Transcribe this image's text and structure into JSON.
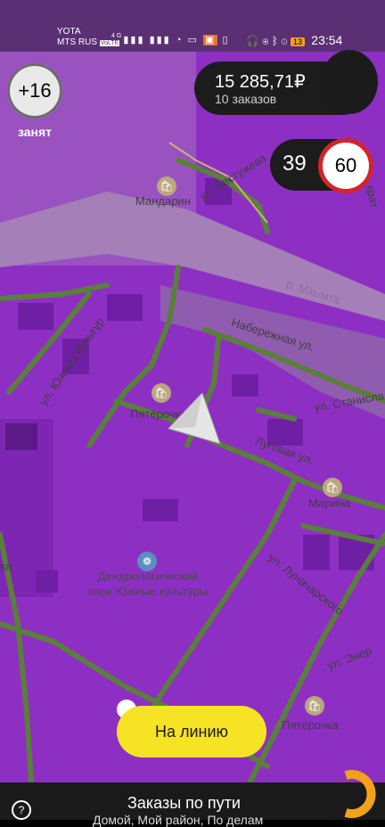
{
  "status_bar": {
    "carrier1": "YOTA",
    "carrier2": "MTS RUS",
    "network_type": "4G",
    "volte_label": "VoLTE",
    "battery": "13",
    "time": "23:54"
  },
  "driver": {
    "bonus": "+16",
    "status": "занят"
  },
  "earnings": {
    "amount": "15 285,71₽",
    "orders": "10 заказов"
  },
  "speed": {
    "current": "39",
    "limit": "60"
  },
  "map": {
    "labels": {
      "bestuzheva": "ул. Бестужева",
      "mandarin": "Мандарин",
      "mzymta": "р. Мзымта",
      "naberezhnaya": "Набережная ул.",
      "yuzhnye_kultury": "ул. Южных Культур",
      "pyaterochka1": "Пятёрочка",
      "stanislav": "ул. Станисла",
      "lugovaya": "Луговая ул.",
      "marina": "Марина",
      "dendropark": "Дендрологический парк Южные культуры",
      "lunacharskogo": "ул. Луначарского",
      "energ": "ул. Энер",
      "pyaterochka2": "Пятёрочка",
      "krat": "крат",
      "ka": "ка"
    }
  },
  "online_button": "На линию",
  "bottom_sheet": {
    "title": "Заказы по пути",
    "subtitle": "Домой, Мой район, По делам"
  },
  "colors": {
    "map_purple": "#8e2fc4",
    "road_green": "#5a7f3a",
    "accent_yellow": "#f5e324",
    "speed_red": "#d2242b",
    "logo_orange": "#f2a21a"
  }
}
